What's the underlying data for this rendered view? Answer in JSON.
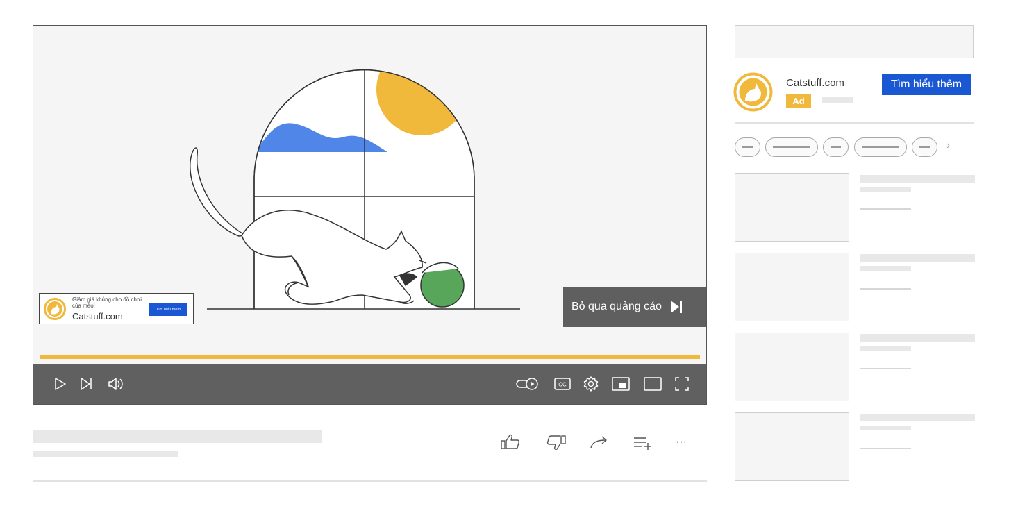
{
  "player": {
    "skip_label": "Bỏ qua quảng cáo",
    "progress_percent": 100,
    "overlay_ad": {
      "text": "Giảm giá khủng cho đồ chơi của mèo!",
      "site": "Catstuff.com",
      "button_label": "Tìm hiểu thêm"
    },
    "controls": {
      "left": [
        "play-icon",
        "next-icon",
        "volume-icon"
      ],
      "right": [
        "autoplay-toggle-icon",
        "captions-icon",
        "settings-gear-icon",
        "miniplayer-icon",
        "theater-mode-icon",
        "fullscreen-icon"
      ],
      "captions_label": "CC"
    }
  },
  "actions": [
    "like-icon",
    "dislike-icon",
    "share-icon",
    "save-playlist-icon",
    "more-icon"
  ],
  "more_label": "···",
  "sidebar": {
    "ad": {
      "site": "Catstuff.com",
      "badge": "Ad",
      "cta_label": "Tìm hiểu thêm"
    },
    "chips_next": "›"
  },
  "colors": {
    "accent_yellow": "#f0b93b",
    "cta_blue": "#1a57d2",
    "controls_gray": "#606060",
    "sky_blue": "#4f86e8",
    "ball_green": "#57a65a"
  }
}
